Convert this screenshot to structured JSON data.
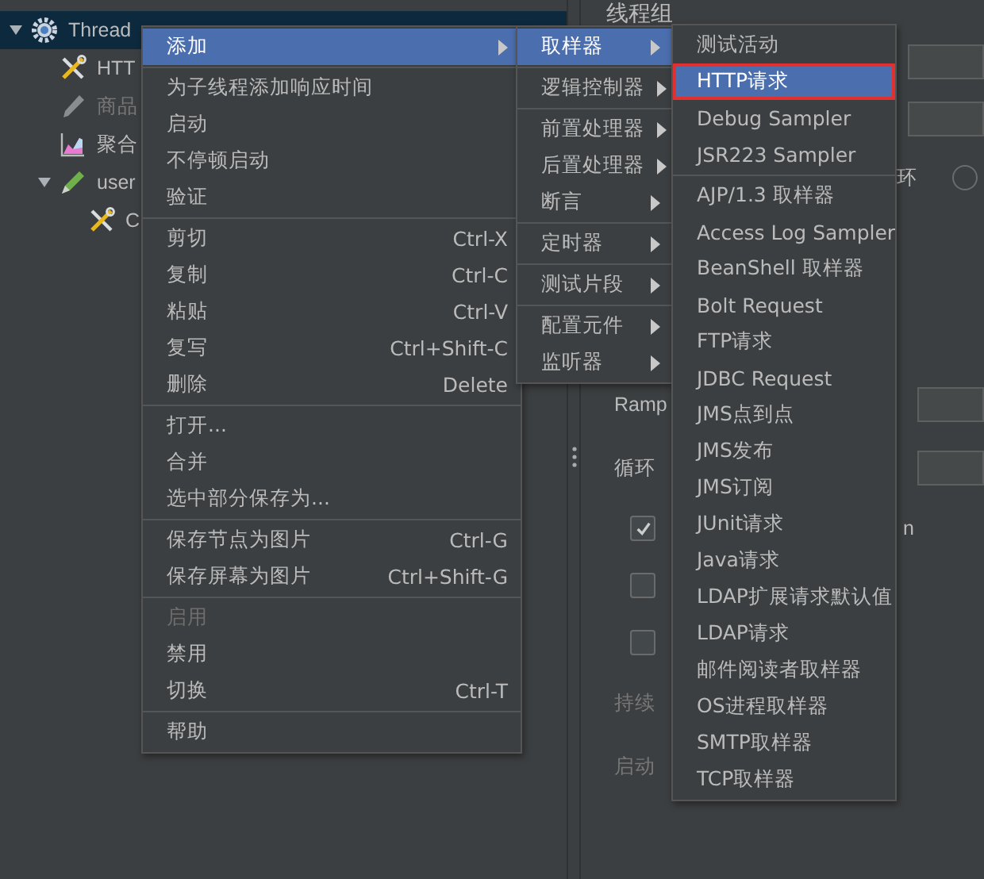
{
  "tree": [
    {
      "label": "Thread",
      "kind": "group",
      "selected": true,
      "disabled": false,
      "expanded": true,
      "children": [
        {
          "label": "HTT",
          "kind": "config",
          "selected": false,
          "disabled": false
        },
        {
          "label": "商品",
          "kind": "controller",
          "selected": false,
          "disabled": true
        },
        {
          "label": "聚合",
          "kind": "listener",
          "selected": false,
          "disabled": false
        },
        {
          "label": "user",
          "kind": "controller",
          "selected": false,
          "disabled": false,
          "expanded": true,
          "children": [
            {
              "label": "C",
              "kind": "config",
              "selected": false,
              "disabled": false
            }
          ]
        }
      ]
    }
  ],
  "panel": {
    "title": "线程组",
    "rows": [
      {
        "kind": "tail",
        "text": "环",
        "radio_checked": false
      },
      {
        "kind": "field",
        "text": "Ramp",
        "disabled": false
      },
      {
        "kind": "field",
        "text": "循环",
        "disabled": false
      },
      {
        "kind": "checkbox",
        "tail": "n",
        "checked": true
      },
      {
        "kind": "checkbox",
        "checked": false
      },
      {
        "kind": "checkbox",
        "checked": false
      },
      {
        "kind": "field",
        "text": "持续",
        "disabled": true
      },
      {
        "kind": "field",
        "text": "启动",
        "disabled": true
      }
    ]
  },
  "context_menu": {
    "groups": [
      [
        {
          "label": "添加",
          "submenu": true,
          "selected": true,
          "disabled": false
        }
      ],
      [
        {
          "label": "为子线程添加响应时间",
          "selected": false,
          "disabled": false
        },
        {
          "label": "启动",
          "selected": false,
          "disabled": false
        },
        {
          "label": "不停顿启动",
          "selected": false,
          "disabled": false
        },
        {
          "label": "验证",
          "selected": false,
          "disabled": false
        }
      ],
      [
        {
          "label": "剪切",
          "shortcut": "Ctrl-X",
          "selected": false,
          "disabled": false
        },
        {
          "label": "复制",
          "shortcut": "Ctrl-C",
          "selected": false,
          "disabled": false
        },
        {
          "label": "粘贴",
          "shortcut": "Ctrl-V",
          "selected": false,
          "disabled": false
        },
        {
          "label": "复写",
          "shortcut": "Ctrl+Shift-C",
          "selected": false,
          "disabled": false
        },
        {
          "label": "删除",
          "shortcut": "Delete",
          "selected": false,
          "disabled": false
        }
      ],
      [
        {
          "label": "打开...",
          "selected": false,
          "disabled": false
        },
        {
          "label": "合并",
          "selected": false,
          "disabled": false
        },
        {
          "label": "选中部分保存为...",
          "selected": false,
          "disabled": false
        }
      ],
      [
        {
          "label": "保存节点为图片",
          "shortcut": "Ctrl-G",
          "selected": false,
          "disabled": false
        },
        {
          "label": "保存屏幕为图片",
          "shortcut": "Ctrl+Shift-G",
          "selected": false,
          "disabled": false
        }
      ],
      [
        {
          "label": "启用",
          "selected": false,
          "disabled": true
        },
        {
          "label": "禁用",
          "selected": false,
          "disabled": false
        },
        {
          "label": "切换",
          "shortcut": "Ctrl-T",
          "selected": false,
          "disabled": false
        }
      ],
      [
        {
          "label": "帮助",
          "selected": false,
          "disabled": false
        }
      ]
    ]
  },
  "add_submenu": {
    "groups": [
      [
        {
          "label": "取样器",
          "submenu": true,
          "selected": true,
          "disabled": false
        }
      ],
      [
        {
          "label": "逻辑控制器",
          "submenu": true,
          "selected": false,
          "disabled": false
        }
      ],
      [
        {
          "label": "前置处理器",
          "submenu": true,
          "selected": false,
          "disabled": false
        },
        {
          "label": "后置处理器",
          "submenu": true,
          "selected": false,
          "disabled": false
        },
        {
          "label": "断言",
          "submenu": true,
          "selected": false,
          "disabled": false
        }
      ],
      [
        {
          "label": "定时器",
          "submenu": true,
          "selected": false,
          "disabled": false
        }
      ],
      [
        {
          "label": "测试片段",
          "submenu": true,
          "selected": false,
          "disabled": false
        }
      ],
      [
        {
          "label": "配置元件",
          "submenu": true,
          "selected": false,
          "disabled": false
        },
        {
          "label": "监听器",
          "submenu": true,
          "selected": false,
          "disabled": false
        }
      ]
    ]
  },
  "sampler_submenu": {
    "groups": [
      [
        {
          "label": "测试活动",
          "selected": false,
          "disabled": false
        },
        {
          "label": "HTTP请求",
          "selected": true,
          "highlighted": true,
          "disabled": false
        },
        {
          "label": "Debug Sampler",
          "selected": false,
          "disabled": false
        },
        {
          "label": "JSR223 Sampler",
          "selected": false,
          "disabled": false
        }
      ],
      [
        {
          "label": "AJP/1.3 取样器",
          "selected": false,
          "disabled": false
        },
        {
          "label": "Access Log Sampler",
          "selected": false,
          "disabled": false
        },
        {
          "label": "BeanShell 取样器",
          "selected": false,
          "disabled": false
        },
        {
          "label": "Bolt Request",
          "selected": false,
          "disabled": false
        },
        {
          "label": "FTP请求",
          "selected": false,
          "disabled": false
        },
        {
          "label": "JDBC Request",
          "selected": false,
          "disabled": false
        },
        {
          "label": "JMS点到点",
          "selected": false,
          "disabled": false
        },
        {
          "label": "JMS发布",
          "selected": false,
          "disabled": false
        },
        {
          "label": "JMS订阅",
          "selected": false,
          "disabled": false
        },
        {
          "label": "JUnit请求",
          "selected": false,
          "disabled": false
        },
        {
          "label": "Java请求",
          "selected": false,
          "disabled": false
        },
        {
          "label": "LDAP扩展请求默认值",
          "selected": false,
          "disabled": false
        },
        {
          "label": "LDAP请求",
          "selected": false,
          "disabled": false
        },
        {
          "label": "邮件阅读者取样器",
          "selected": false,
          "disabled": false
        },
        {
          "label": "OS进程取样器",
          "selected": false,
          "disabled": false
        },
        {
          "label": "SMTP取样器",
          "selected": false,
          "disabled": false
        },
        {
          "label": "TCP取样器",
          "selected": false,
          "disabled": false
        }
      ]
    ]
  }
}
